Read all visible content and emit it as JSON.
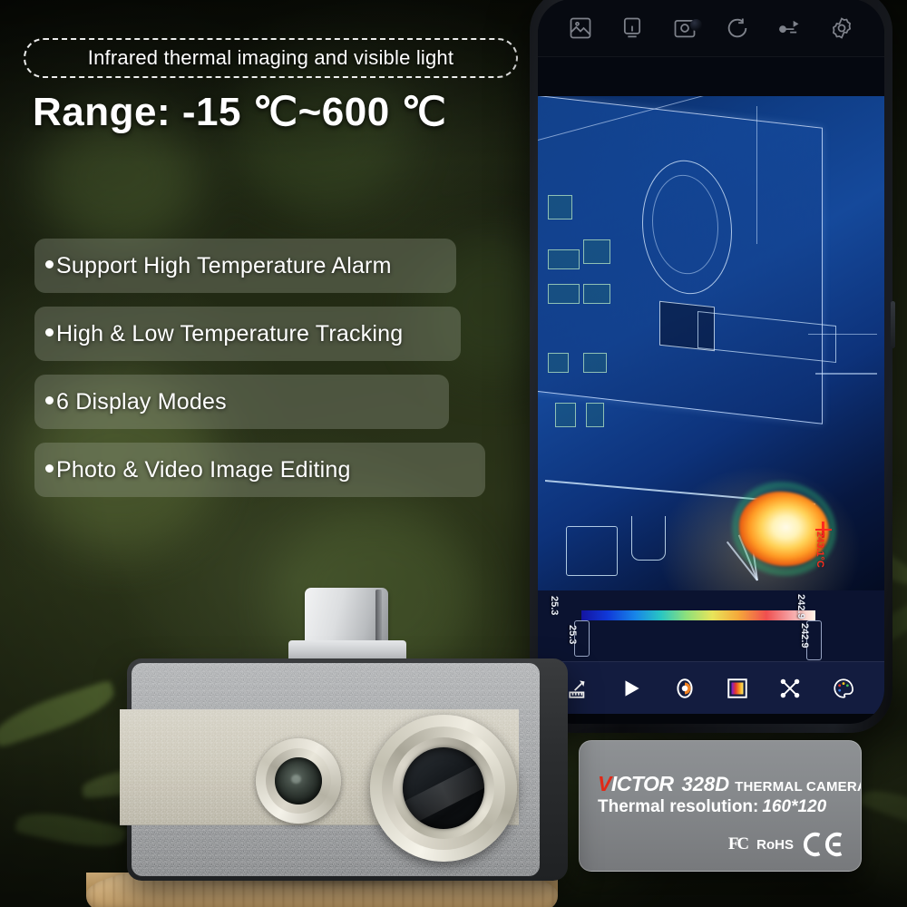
{
  "headline": {
    "chip_text": "Infrared thermal imaging and visible light",
    "range_text": "Range: -15 ℃~600 ℃"
  },
  "features": [
    {
      "bullet": "•",
      "label": "Support High Temperature Alarm"
    },
    {
      "bullet": "•",
      "label": "High & Low Temperature Tracking"
    },
    {
      "bullet": "•",
      "label": "6 Display Modes"
    },
    {
      "bullet": "•",
      "label": "Photo & Video Image Editing"
    }
  ],
  "phone": {
    "top_toolbar": [
      {
        "icon": "image-gallery-icon",
        "label": "Gallery"
      },
      {
        "icon": "screen-display-icon",
        "label": "Display"
      },
      {
        "icon": "camera-icon",
        "label": "Camera"
      },
      {
        "icon": "rotate-icon",
        "label": "Rotate"
      },
      {
        "icon": "video-record-icon",
        "label": "Video"
      },
      {
        "icon": "gear-icon",
        "label": "Settings"
      }
    ],
    "bottom_toolbar": [
      {
        "icon": "measure-ruler-icon",
        "label": "Measure"
      },
      {
        "icon": "play-triangle-icon",
        "label": "Play"
      },
      {
        "icon": "contrast-icon",
        "label": "Contrast"
      },
      {
        "icon": "color-palette-swatch-icon",
        "label": "Palette"
      },
      {
        "icon": "crosshair-analysis-icon",
        "label": "Analysis"
      },
      {
        "icon": "paint-palette-icon",
        "label": "Color Mode"
      }
    ],
    "scale": {
      "min_label_outer": "25.3",
      "min_label_inner": "25.3",
      "max_label_outer": "242.9",
      "max_label_inner": "242.9"
    },
    "reading": {
      "value": "243.1°C",
      "marker": "crosshair"
    }
  },
  "label_plate": {
    "brand_red": "V",
    "brand_rest": "ICTOR",
    "model": "328D",
    "product_type": "THERMAL CAMERA",
    "resolution_prefix": "Thermal resolution:",
    "resolution_value": "160*120",
    "certs": {
      "fc": "FC",
      "rohs": "RoHS",
      "ce": "CE"
    }
  },
  "colors": {
    "accent_red": "#e22a18",
    "text_white": "#ffffff",
    "feature_box": "rgba(168,176,160,0.30)",
    "thermal_blue": "#15499b",
    "phone_toolbar": "#131c3f"
  }
}
